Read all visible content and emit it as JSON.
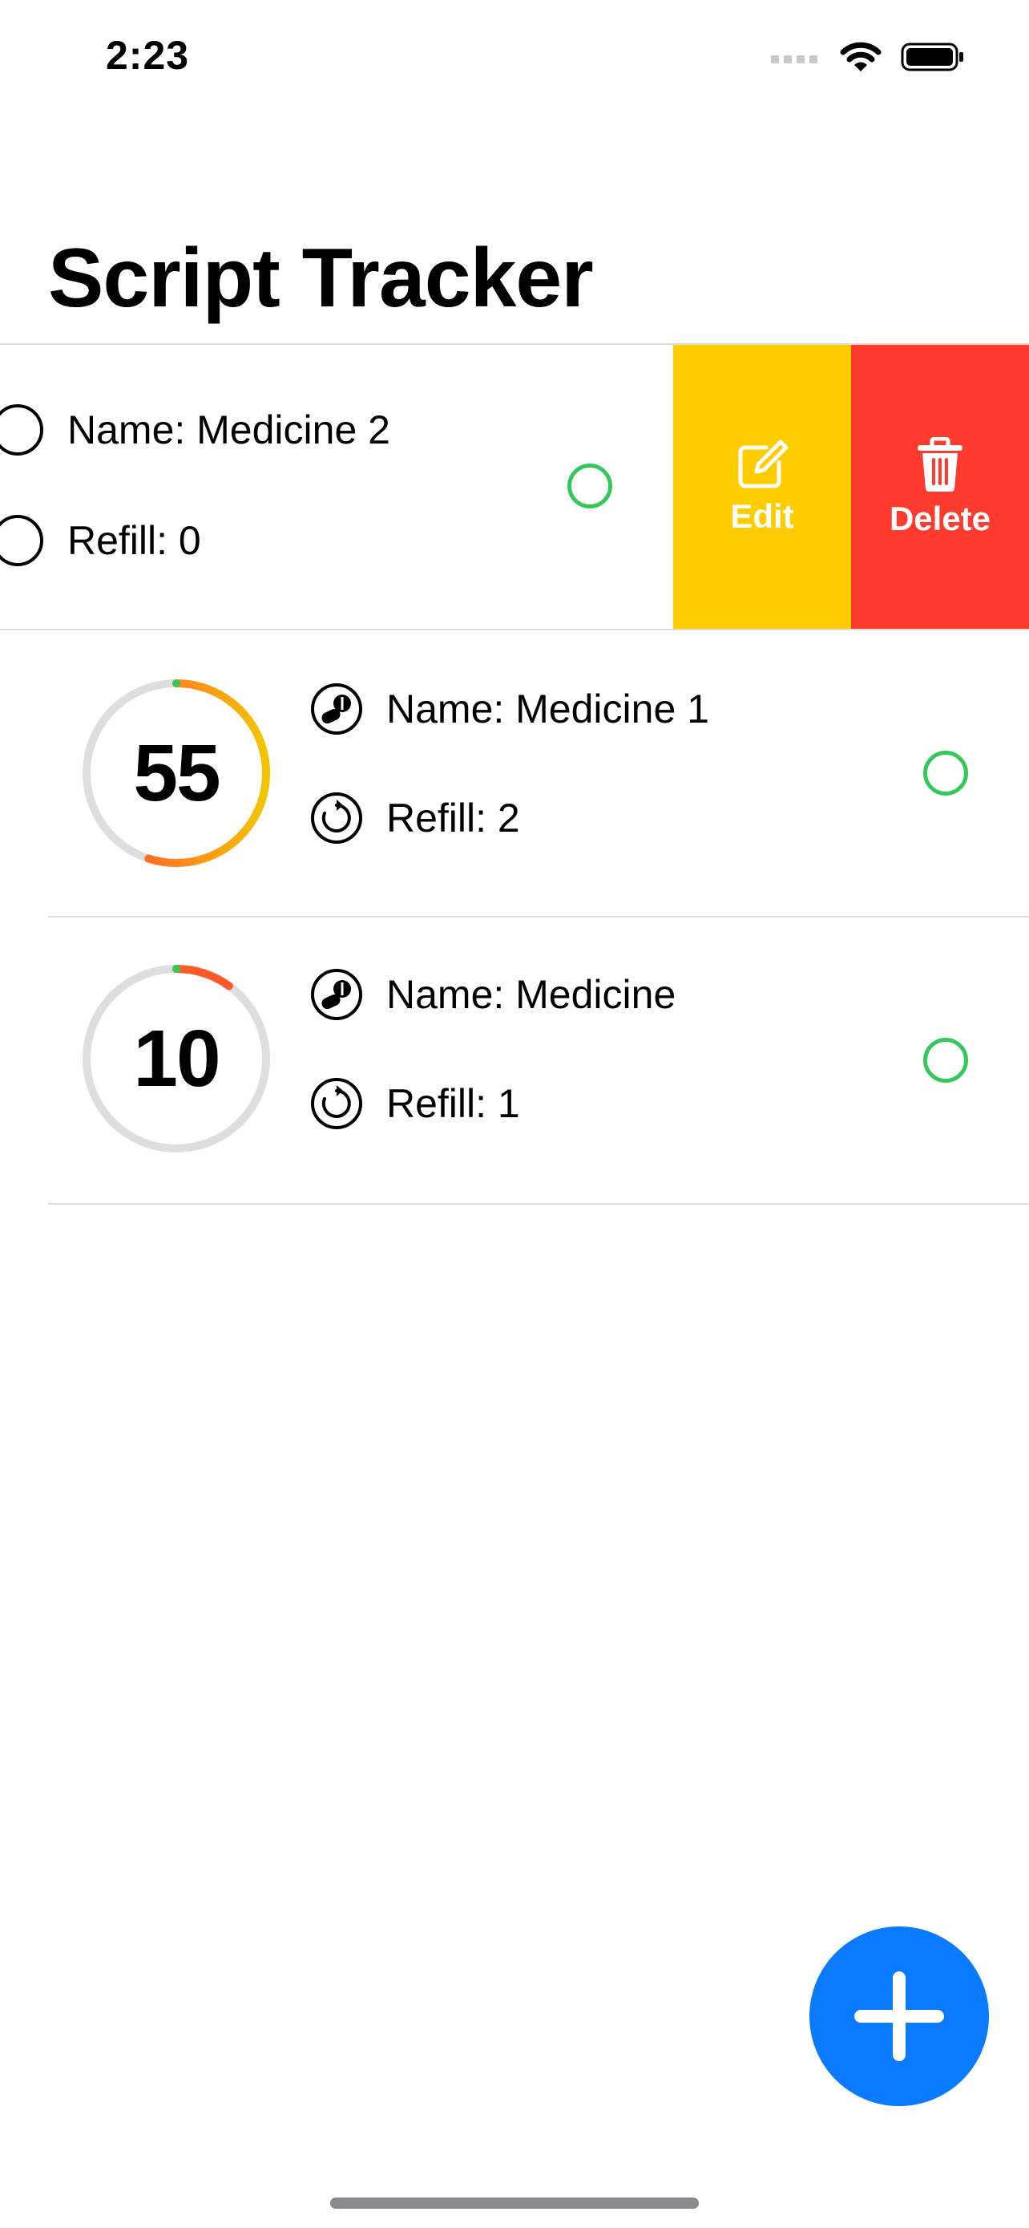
{
  "status_bar": {
    "time": "2:23"
  },
  "app": {
    "title": "Script Tracker"
  },
  "colors": {
    "accent": "#0a7aff",
    "edit": "#ffcc00",
    "delete": "#ff3b30",
    "check": "#34c759",
    "ring_track": "#dedede"
  },
  "actions": {
    "edit_label": "Edit",
    "delete_label": "Delete"
  },
  "items": [
    {
      "name": "Name: Medicine 2",
      "refill": "Refill: 0"
    },
    {
      "count": "55",
      "name": "Name: Medicine 1",
      "refill": "Refill: 2",
      "progress": 0.55
    },
    {
      "count": "10",
      "name": "Name: Medicine",
      "refill": "Refill: 1",
      "progress": 0.1
    }
  ]
}
